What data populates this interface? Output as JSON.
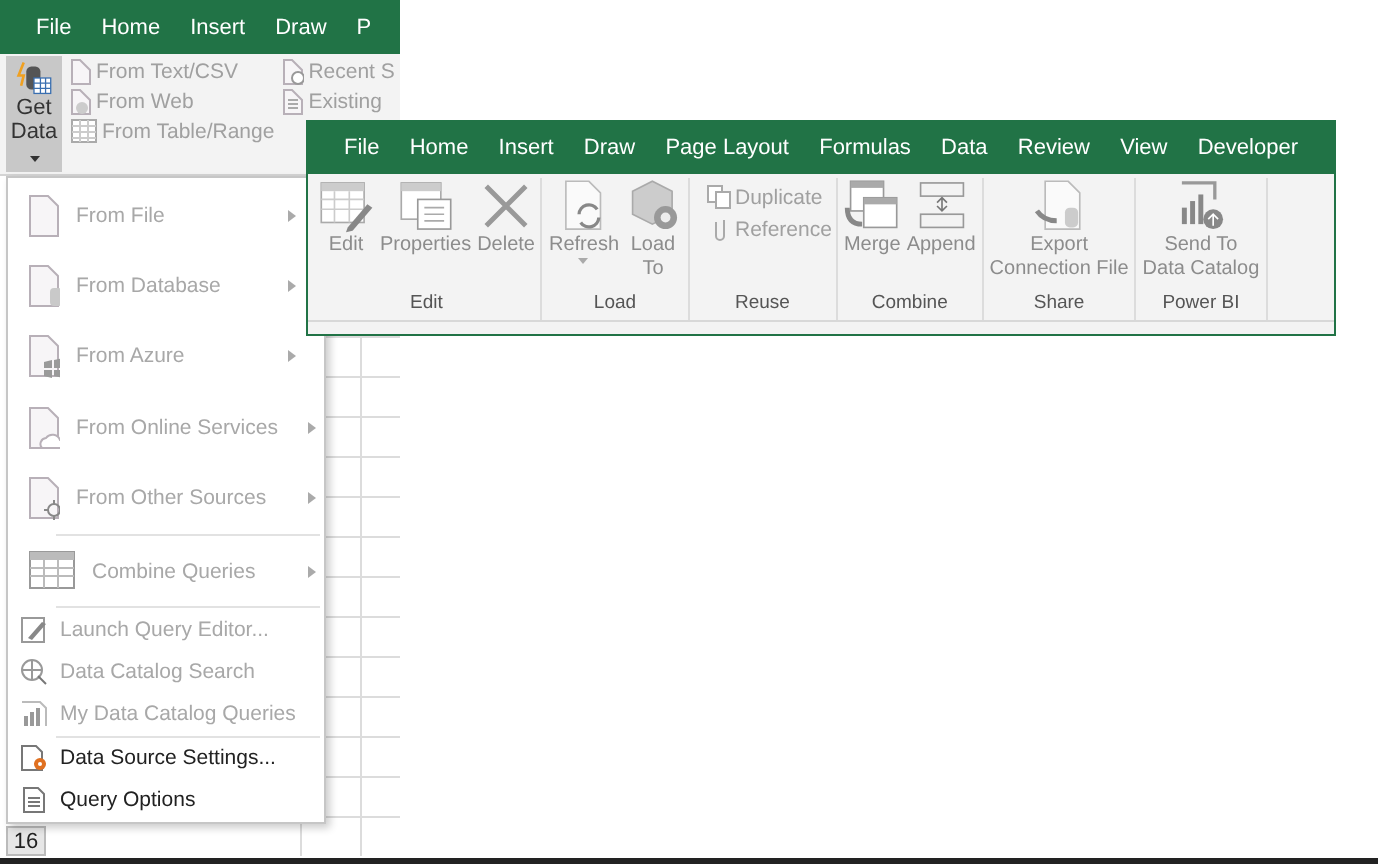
{
  "back_window": {
    "tabs": [
      {
        "label": "File"
      },
      {
        "label": "Home"
      },
      {
        "label": "Insert"
      },
      {
        "label": "Draw"
      },
      {
        "label": "P"
      }
    ],
    "get_data": {
      "top": "Get",
      "bottom": "Data",
      "pressed": true
    },
    "import_commands": [
      {
        "label": "From Text/CSV",
        "disabled": true
      },
      {
        "label": "From Web",
        "disabled": true
      },
      {
        "label": "From Table/Range",
        "disabled": true
      }
    ],
    "recent_commands": [
      {
        "label": "Recent S",
        "disabled": true
      },
      {
        "label": "Existing",
        "disabled": true
      }
    ],
    "row_header": "16"
  },
  "menu": {
    "sections": [
      [
        {
          "kind": "large",
          "label": "From File",
          "disabled": true
        },
        {
          "kind": "large",
          "label": "From Database",
          "disabled": true
        },
        {
          "kind": "large",
          "label": "From Azure",
          "disabled": true
        },
        {
          "kind": "large",
          "label": "From Online Services",
          "disabled": true
        },
        {
          "kind": "large",
          "label": "From Other Sources",
          "disabled": true
        }
      ],
      [
        {
          "kind": "large",
          "label": "Combine Queries",
          "disabled": true
        }
      ],
      [
        {
          "kind": "small",
          "label": "Launch Query Editor...",
          "disabled": true
        },
        {
          "kind": "small",
          "label": "Data Catalog Search",
          "disabled": true
        },
        {
          "kind": "small",
          "label": "My Data Catalog Queries",
          "disabled": true
        }
      ],
      [
        {
          "kind": "small",
          "label": "Data Source Settings...",
          "disabled": false
        },
        {
          "kind": "small",
          "label": "Query Options",
          "disabled": false
        }
      ]
    ]
  },
  "front_window": {
    "tabs": [
      {
        "label": "File"
      },
      {
        "label": "Home"
      },
      {
        "label": "Insert"
      },
      {
        "label": "Draw"
      },
      {
        "label": "Page Layout"
      },
      {
        "label": "Formulas"
      },
      {
        "label": "Data"
      },
      {
        "label": "Review"
      },
      {
        "label": "View"
      },
      {
        "label": "Developer"
      }
    ],
    "groups": [
      {
        "label": "Edit",
        "commands": [
          {
            "kind": "large",
            "label": "Edit"
          },
          {
            "kind": "large",
            "label": "Properties"
          },
          {
            "kind": "large",
            "label": "Delete"
          }
        ]
      },
      {
        "label": "Load",
        "commands": [
          {
            "kind": "large",
            "label": "Refresh",
            "dropdown": true
          },
          {
            "kind": "large",
            "label": "Load\nTo"
          }
        ]
      },
      {
        "label": "Reuse",
        "commands": [
          {
            "kind": "small",
            "label": "Duplicate"
          },
          {
            "kind": "small",
            "label": "Reference"
          }
        ]
      },
      {
        "label": "Combine",
        "commands": [
          {
            "kind": "large",
            "label": "Merge"
          },
          {
            "kind": "large",
            "label": "Append"
          }
        ]
      },
      {
        "label": "Share",
        "commands": [
          {
            "kind": "large",
            "label": "Export\nConnection File"
          }
        ]
      },
      {
        "label": "Power BI",
        "commands": [
          {
            "kind": "large",
            "label": "Send To\nData Catalog"
          }
        ]
      }
    ]
  }
}
